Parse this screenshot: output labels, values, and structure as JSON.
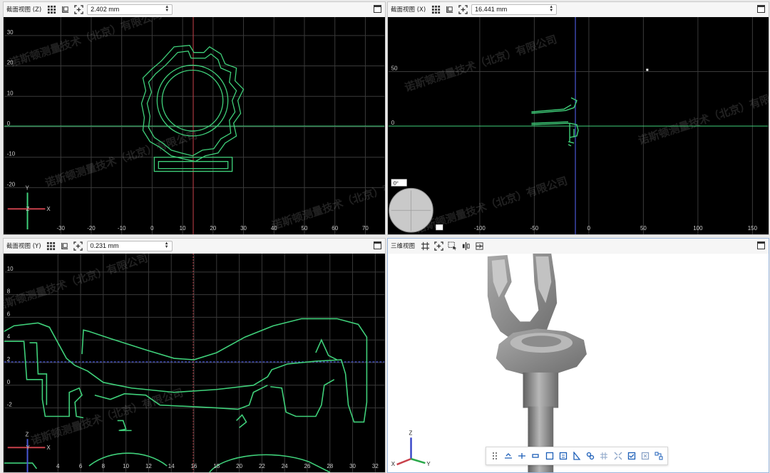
{
  "views": {
    "top_left": {
      "title": "截面视图 (Z)",
      "value": "2.402 mm"
    },
    "top_right": {
      "title": "截面视图 (X)",
      "value": "16.441 mm"
    },
    "bottom_left": {
      "title": "截面视图 (Y)",
      "value": "0.231 mm"
    },
    "bottom_right": {
      "title": "三维视图"
    }
  },
  "axes": {
    "z_view": {
      "x_ticks": [
        "-30",
        "-20",
        "-10",
        "0",
        "10",
        "20",
        "30",
        "40",
        "50",
        "60",
        "70"
      ],
      "y_ticks": [
        "30",
        "20",
        "10",
        "0",
        "-10",
        "-20"
      ],
      "axis_labels": {
        "vertical": "Y",
        "horizontal": "X",
        "origin": "Z"
      }
    },
    "x_view": {
      "x_ticks": [
        "-100",
        "-50",
        "0",
        "50",
        "100",
        "150"
      ],
      "y_ticks": [
        "50",
        "0"
      ],
      "rotation_label": "0°"
    },
    "y_view": {
      "x_ticks": [
        "4",
        "6",
        "8",
        "10",
        "12",
        "14",
        "16",
        "18",
        "20",
        "22",
        "24",
        "26",
        "28",
        "30",
        "32"
      ],
      "y_ticks": [
        "10",
        "8",
        "6",
        "4",
        "2",
        "0",
        "-2"
      ],
      "axis_labels": {
        "vertical": "Z",
        "horizontal": "X",
        "origin": "Y"
      }
    },
    "view3d": {
      "axis_labels": {
        "up": "Z",
        "left": "X",
        "right": "Y"
      }
    }
  },
  "watermark": "诺斯顿测量技术（北京）有限公司",
  "colors": {
    "contour": "#3fd07a",
    "cursor_red": "#c8414b",
    "cursor_blue": "#4a58d6",
    "grid": "#3a3a3a",
    "part_gray": "#8a8a8a"
  },
  "icons": {
    "section_toolbar": [
      "grid-icon",
      "reset-view-icon",
      "fit-view-icon"
    ],
    "view3d_toolbar": [
      "grid-icon",
      "fit-view-icon",
      "select-region-icon",
      "mirror-icon",
      "section-plane-icon"
    ],
    "bottom_toolbar": [
      "drag-handle-icon",
      "measure-point-icon",
      "measure-line-icon",
      "probe-icon",
      "box-icon",
      "note-icon",
      "angle-icon",
      "link-icon",
      "grid-select-icon",
      "expand-icon",
      "checkbox-icon",
      "close-box-icon",
      "group-icon"
    ]
  }
}
